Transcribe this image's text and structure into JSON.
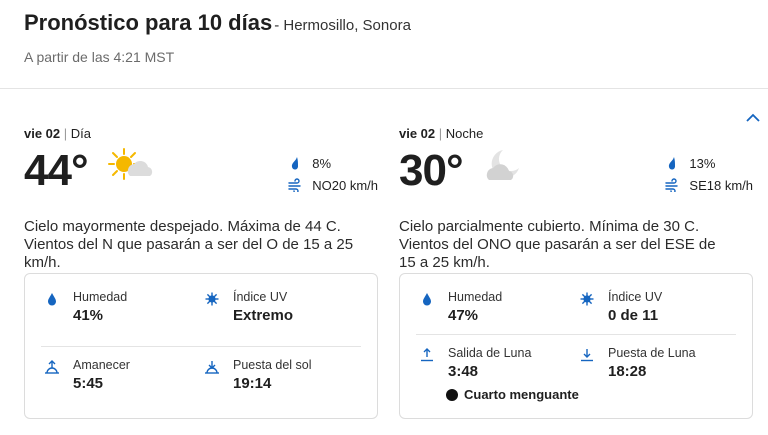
{
  "header": {
    "title": "Pronóstico para 10 días",
    "location": "- Hermosillo, Sonora",
    "as_of": "A partir de las 4:21 MST"
  },
  "day": {
    "date": "vie 02",
    "separator": "|",
    "period": "Día",
    "temperature": "44°",
    "weather_icon": "sun-cloud-icon",
    "precipitation": "8%",
    "wind": "NO20 km/h",
    "description": "Cielo mayormente despejado. Máxima de 44 C. Vientos del N que pasarán a ser del O de 15 a 25 km/h.",
    "details": {
      "humidity_label": "Humedad",
      "humidity_value": "41%",
      "uv_label": "Índice UV",
      "uv_value": "Extremo",
      "sunrise_label": "Amanecer",
      "sunrise_value": "5:45",
      "sunset_label": "Puesta del sol",
      "sunset_value": "19:14"
    }
  },
  "night": {
    "date": "vie 02",
    "separator": "|",
    "period": "Noche",
    "temperature": "30°",
    "weather_icon": "moon-cloud-icon",
    "precipitation": "13%",
    "wind": "SE18 km/h",
    "description": "Cielo parcialmente cubierto. Mínima de 30 C. Vientos del ONO que pasarán a ser del ESE de 15 a 25 km/h.",
    "details": {
      "humidity_label": "Humedad",
      "humidity_value": "47%",
      "uv_label": "Índice UV",
      "uv_value": "0 de 11",
      "moonrise_label": "Salida de Luna",
      "moonrise_value": "3:48",
      "moonset_label": "Puesta de Luna",
      "moonset_value": "18:28",
      "moon_phase": "Cuarto menguante"
    }
  },
  "colors": {
    "accent": "#1565c0",
    "sun": "#f5b800",
    "cloud": "#d6d6d6"
  }
}
